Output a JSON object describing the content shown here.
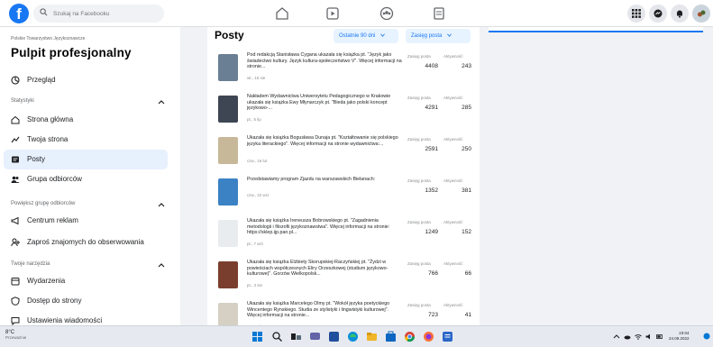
{
  "topbar": {
    "logo": "f",
    "search_placeholder": "Szukaj na Facebooku",
    "nav_icons": [
      "home-icon",
      "video-icon",
      "groups-icon",
      "pages-icon"
    ],
    "right_icons": [
      "grid-menu-icon",
      "messenger-icon",
      "bell-icon",
      "profile-icon"
    ]
  },
  "sidebar": {
    "breadcrumb": "Polskie Towarzystwo Językoznawcze",
    "title": "Pulpit profesjonalny",
    "overview": "Przegląd",
    "sections": [
      {
        "header": "Statystyki",
        "items": [
          "Strona główna",
          "Twoja strona",
          "Posty",
          "Grupa odbiorców"
        ]
      },
      {
        "header": "Powiększ grupę odbiorców",
        "items": [
          "Centrum reklam",
          "Zaproś znajomych do obserwowania"
        ]
      },
      {
        "header": "Twoje narzędzia",
        "items": [
          "Wydarzenia",
          "Dostęp do strony",
          "Ustawienia wiadomości"
        ]
      }
    ],
    "active_item": "Posty"
  },
  "main": {
    "title": "Posty",
    "filter_range": "Ostatnie 90 dni",
    "filter_metric": "Zasięg posta",
    "metric_reach_label": "Zasięg posta",
    "metric_activity_label": "Aktywność",
    "posts": [
      {
        "text": "Pod redakcją Stanisława Cygana ukazała się książka pt. \"Język jako świadectwo kultury. Język kultura-społeczeństwo V\". Więcej informacji na stronie...",
        "date": "wt., 16 sie",
        "reach": "4408",
        "activity": "243",
        "thumb": "#6b7f94"
      },
      {
        "text": "Nakładem Wydawnictwa Uniwersytetu Pedagogicznego w Krakowie ukazała się książka Ewy Młynarczyk pt. \"Bieda jako polski koncept językowo-...",
        "date": "pt., 5 lip",
        "reach": "4291",
        "activity": "285",
        "thumb": "#3d4652"
      },
      {
        "text": "Ukazała się książka Bogusława Dunaja pt. \"Kształtowanie się polskiego języka literackiego\". Więcej informacji na stronie wydawnictwa:...",
        "date": "czw., 16 lut",
        "reach": "2591",
        "activity": "250",
        "thumb": "#c8b89a"
      },
      {
        "text": "Przedstawiamy program Zjazdu na warszawskich Bielanach:",
        "date": "czw., 22 wrz",
        "reach": "1352",
        "activity": "381",
        "thumb": "#3b82c4"
      },
      {
        "text": "Ukazała się książka Ireneusza Bobrowskiego pt. \"Zagadnienia metodologii i filozofii językoznawstwa\". Więcej informacji na stronie: https://sklep.ijp.pan.pl...",
        "date": "pt., 7 wrz",
        "reach": "1249",
        "activity": "152",
        "thumb": "#e9ecef"
      },
      {
        "text": "Ukazała się książka Elżbiety Skorupskiej-Raczyńskiej pt. \"Żydzi w powieściach współczesnych Eliry Orzeszkowej (studium językowo-kulturowe)\". Gorzów Wielkopolsk...",
        "date": "pt., 3 sie",
        "reach": "766",
        "activity": "66",
        "thumb": "#7a3e2e"
      },
      {
        "text": "Ukazała się książka Marcelego Olmy pt. \"Wokół języka poetyckiego Wincentego Rynskiego. Studia ze stylistyki i lingwistyki kulturowej\". Więcej informacji na stronie...",
        "date": "pt., 27 lip",
        "reach": "723",
        "activity": "41",
        "thumb": "#d6d0c4"
      }
    ]
  },
  "taskbar": {
    "temperature": "8°C",
    "weather_desc": "Przeważnie",
    "time": "23:04",
    "date": "24.09.2022"
  }
}
